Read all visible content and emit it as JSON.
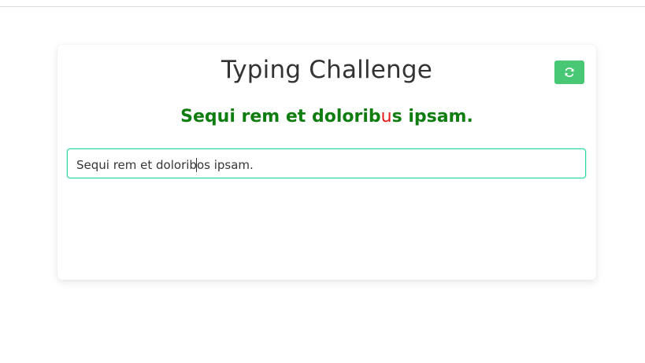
{
  "app": {
    "title": "Typing Challenge"
  },
  "toolbar": {
    "refresh_icon": "refresh-icon",
    "refresh_color": "#48c774"
  },
  "challenge": {
    "target_before": "Sequi rem et dolorib",
    "target_error_char": "u",
    "target_after": "s ipsam.",
    "correct_color": "#0f7d0f",
    "error_color": "#e31b1b"
  },
  "input": {
    "value_before_caret": "Sequi rem et dolorib",
    "value_after_caret": "os ipsam.",
    "focus_color": "#2bd9a4"
  }
}
